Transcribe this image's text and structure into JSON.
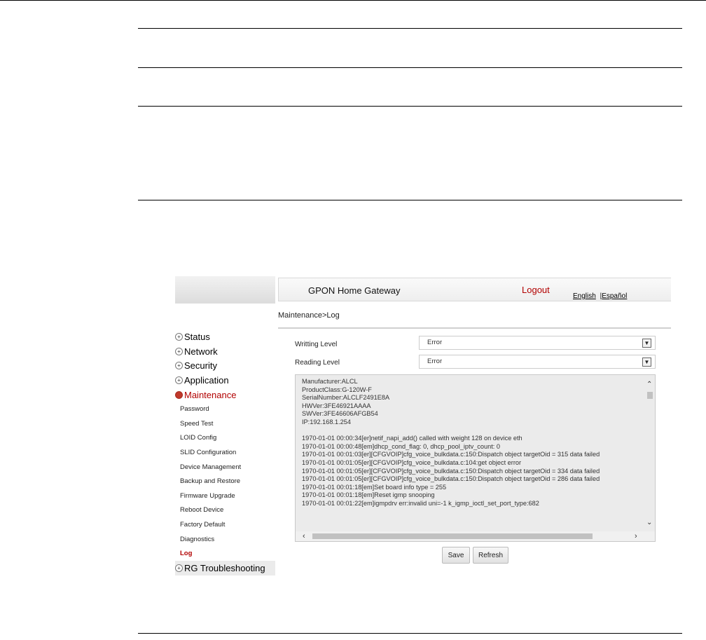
{
  "header": {
    "app_title": "GPON Home Gateway",
    "logout": "Logout",
    "lang_english": "English",
    "lang_separator": "|",
    "lang_espanol": "Español"
  },
  "breadcrumb": "Maintenance>Log",
  "sidebar": {
    "top_items": [
      {
        "label": "Status"
      },
      {
        "label": "Network"
      },
      {
        "label": "Security"
      },
      {
        "label": "Application"
      },
      {
        "label": "Maintenance"
      }
    ],
    "sub_items": [
      {
        "label": "Password"
      },
      {
        "label": "Speed Test"
      },
      {
        "label": "LOID Config"
      },
      {
        "label": "SLID Configuration"
      },
      {
        "label": "Device Management"
      },
      {
        "label": "Backup and Restore"
      },
      {
        "label": "Firmware Upgrade"
      },
      {
        "label": "Reboot Device"
      },
      {
        "label": "Factory Default"
      },
      {
        "label": "Diagnostics"
      },
      {
        "label": "Log"
      }
    ],
    "bottom_item": {
      "label": "RG Troubleshooting"
    }
  },
  "form": {
    "writing_label": "Writting Level",
    "writing_value": "Error",
    "reading_label": "Reading Level",
    "reading_value": "Error"
  },
  "log_lines": [
    "Manufacturer:ALCL",
    "ProductClass:G-120W-F",
    "SerialNumber:ALCLF2491E8A",
    "HWVer:3FE46921AAAA",
    "SWVer:3FE46606AFGB54",
    "IP:192.168.1.254",
    "",
    "1970-01-01 00:00:34[er]netif_napi_add() called with weight 128 on device eth",
    "1970-01-01 00:00:48[em]dhcp_cond_flag: 0, dhcp_pool_iptv_count: 0",
    "1970-01-01 00:01:03[er][CFGVOIP]cfg_voice_bulkdata.c:150:Dispatch object targetOid = 315 data failed",
    "1970-01-01 00:01:05[er][CFGVOIP]cfg_voice_bulkdata.c:104:get object error",
    "1970-01-01 00:01:05[er][CFGVOIP]cfg_voice_bulkdata.c:150:Dispatch object targetOid = 334 data failed",
    "1970-01-01 00:01:05[er][CFGVOIP]cfg_voice_bulkdata.c:150:Dispatch object targetOid = 286 data failed",
    "1970-01-01 00:01:18[em]Set board info type = 255",
    "1970-01-01 00:01:18[em]Reset igmp snooping",
    "1970-01-01 00:01:22[em]igmpdrv err:invalid uni=-1 k_igmp_ioctl_set_port_type:682"
  ],
  "buttons": {
    "save": "Save",
    "refresh": "Refresh"
  }
}
